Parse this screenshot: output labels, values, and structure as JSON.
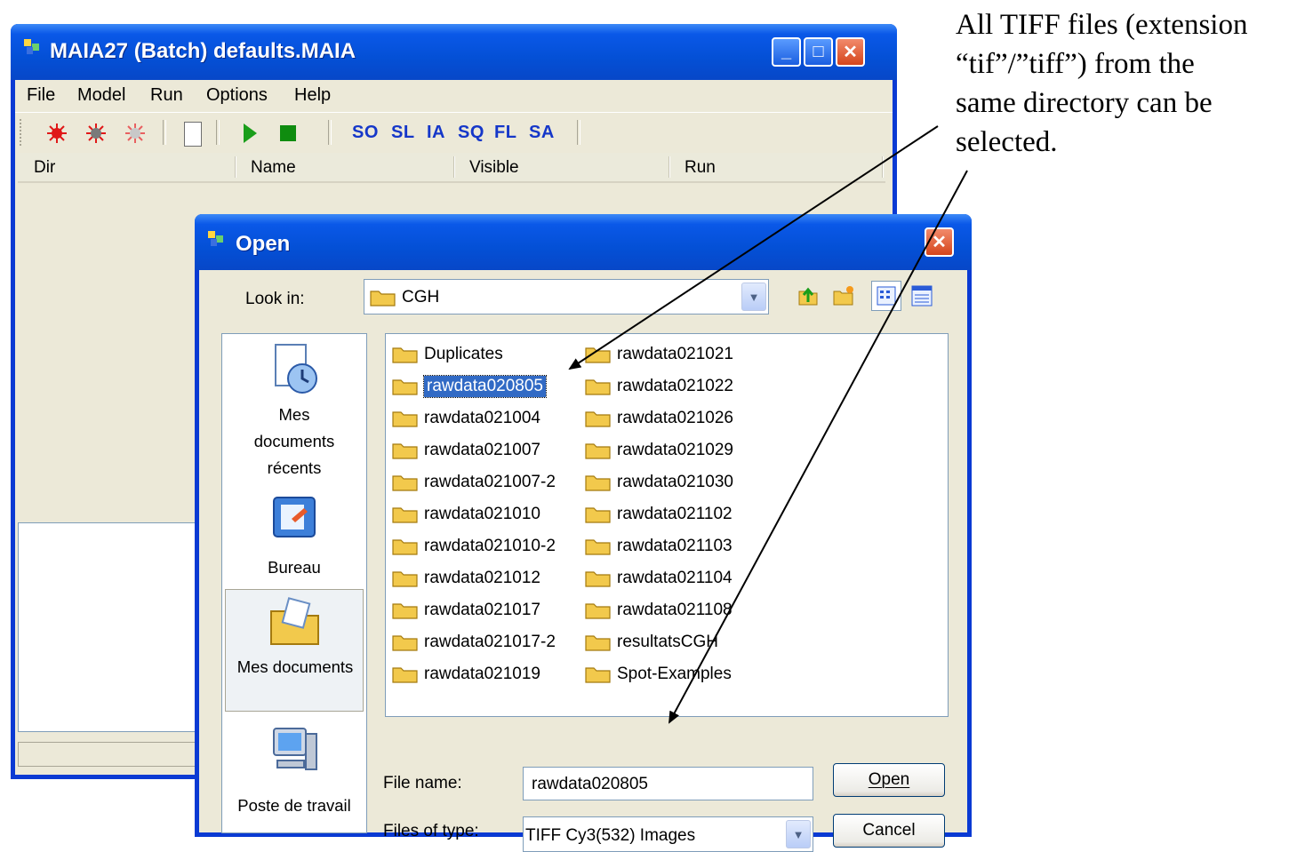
{
  "main_window": {
    "title": "MAIA27 (Batch) defaults.MAIA",
    "menu": [
      "File",
      "Model",
      "Run",
      "Options",
      "Help"
    ],
    "toolbar": {
      "text_buttons": [
        "SO",
        "SL",
        "IA",
        "SQ",
        "FL",
        "SA"
      ]
    },
    "columns": [
      "Dir",
      "Name",
      "Visible",
      "Run"
    ],
    "title_buttons": {
      "minimize": "_",
      "maximize": "□",
      "close": "✕"
    }
  },
  "open_dialog": {
    "title": "Open",
    "close_glyph": "✕",
    "look_in_label": "Look in:",
    "look_in_value": "CGH",
    "places": [
      "Mes documents récents",
      "Bureau",
      "Mes documents",
      "Poste de travail"
    ],
    "places_lines": {
      "recent": [
        "Mes",
        "documents",
        "récents"
      ],
      "desktop": "Bureau",
      "mydocs": "Mes documents",
      "computer": "Poste de travail"
    },
    "files_col1": [
      "Duplicates",
      "rawdata020805",
      "rawdata021004",
      "rawdata021007",
      "rawdata021007-2",
      "rawdata021010",
      "rawdata021010-2",
      "rawdata021012",
      "rawdata021017",
      "rawdata021017-2",
      "rawdata021019"
    ],
    "files_col2": [
      "rawdata021021",
      "rawdata021022",
      "rawdata021026",
      "rawdata021029",
      "rawdata021030",
      "rawdata021102",
      "rawdata021103",
      "rawdata021104",
      "rawdata021108",
      "resultatsCGH",
      "Spot-Examples"
    ],
    "selected_file": "rawdata020805",
    "file_name_label": "File name:",
    "file_name_value": "rawdata020805",
    "files_of_type_label": "Files of type:",
    "files_of_type_value": "TIFF Cy3(532) Images",
    "open_button": "Open",
    "cancel_button": "Cancel"
  },
  "annotation": {
    "lines": [
      "All TIFF files (extension",
      "“tif”/”tiff”) from the",
      "same directory can be",
      "selected."
    ]
  },
  "colors": {
    "title_blue": "#0a58e8",
    "selection": "#316ac5",
    "toolbar_text": "#1537c9",
    "dialog_bg": "#ece9d8"
  }
}
